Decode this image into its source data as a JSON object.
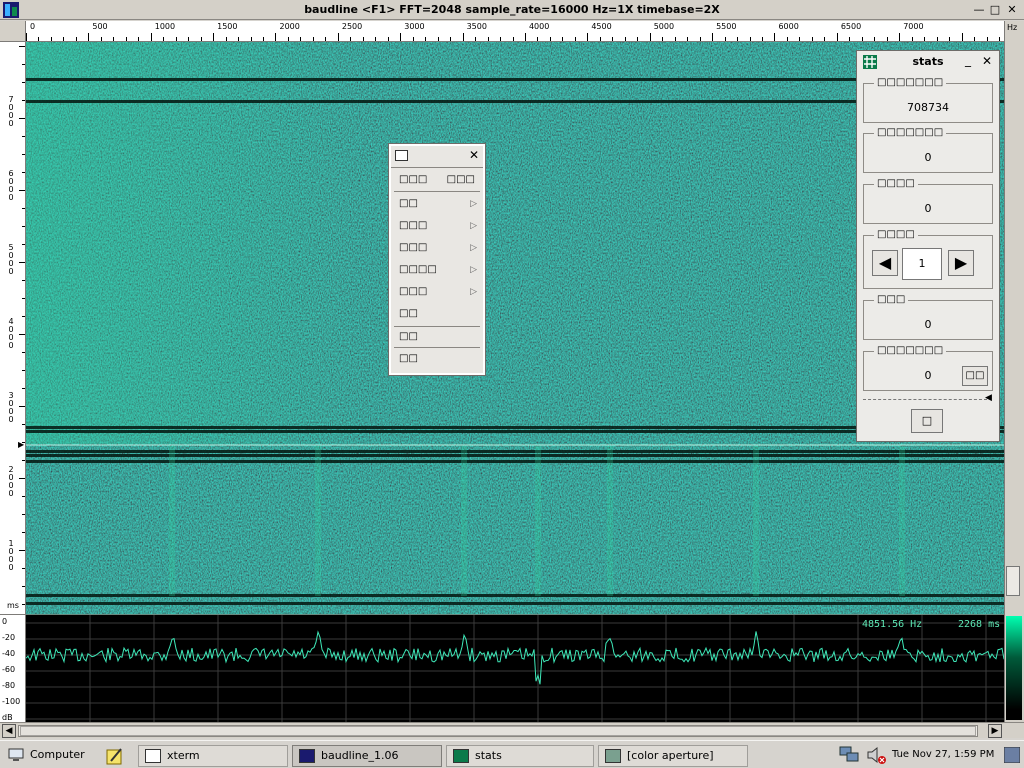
{
  "window": {
    "title": "baudline  <F1> FFT=2048 sample_rate=16000 Hz=1X timebase=2X",
    "minimize_glyph": "—",
    "maximize_glyph": "□",
    "close_glyph": "✕"
  },
  "ruler": {
    "hz_unit": "Hz",
    "x_ticks": [
      "0",
      "500",
      "1000",
      "1500",
      "2000",
      "2500",
      "3000",
      "3500",
      "4000",
      "4500",
      "5000",
      "5500",
      "6000",
      "6500",
      "7000"
    ],
    "ms_unit": "ms",
    "y_ticks": [
      "7000",
      "6000",
      "5000",
      "4000",
      "3000",
      "2000",
      "1000"
    ]
  },
  "spectrum": {
    "frequency_readout": "4851.56 Hz",
    "time_readout": "2268 ms",
    "db_unit": "dB",
    "db_ticks": [
      "0",
      "-20",
      "-40",
      "-60",
      "-80",
      "-100"
    ]
  },
  "popup_menu": {
    "header_left": "□□□",
    "header_right": "□□□",
    "close_glyph": "✕",
    "items": [
      {
        "label": "□□",
        "submenu": "▷"
      },
      {
        "label": "□□□",
        "submenu": "▷"
      },
      {
        "label": "□□□",
        "submenu": "▷"
      },
      {
        "label": "□□□□",
        "submenu": "▷"
      },
      {
        "label": "□□□",
        "submenu": "▷"
      },
      {
        "label": "□□",
        "submenu": ""
      }
    ],
    "footer_items": [
      "□□",
      "□□"
    ]
  },
  "stats": {
    "title": "stats",
    "minimize_glyph": "_",
    "close_glyph": "✕",
    "groups": [
      {
        "label": "□□□□□□□",
        "value": "708734"
      },
      {
        "label": "□□□□□□□",
        "value": "0"
      },
      {
        "label": "□□□□",
        "value": "0"
      },
      {
        "label": "□□□□",
        "value": "1"
      },
      {
        "label": "□□□",
        "value": "0"
      },
      {
        "label": "□□□□□□□",
        "value": "0"
      }
    ],
    "prev_glyph": "◀",
    "next_glyph": "▶",
    "reset_label": "□□",
    "bottom_button": "□"
  },
  "taskbar": {
    "computer": "Computer",
    "tasks": [
      {
        "label": "xterm",
        "active": false
      },
      {
        "label": "baudline_1.06",
        "active": true
      },
      {
        "label": "stats",
        "active": false
      },
      {
        "label": "[color aperture]",
        "active": false
      }
    ],
    "clock": "Tue Nov 27,  1:59 PM"
  },
  "colors": {
    "spectrogram_base": "#0e3a2e",
    "spectrogram_accent": "#2fd6a0",
    "spectrum_trace": "#3ee8b8",
    "readout": "#5ee8b5"
  }
}
